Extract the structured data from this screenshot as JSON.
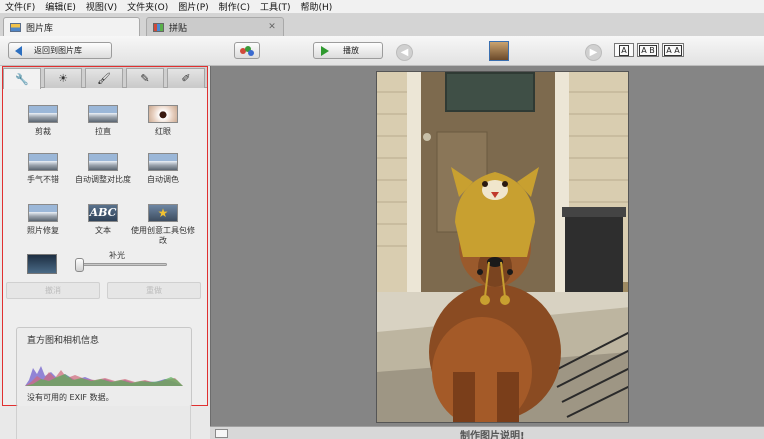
{
  "menu": [
    "文件(F)",
    "编辑(E)",
    "视图(V)",
    "文件夹(O)",
    "图片(P)",
    "制作(C)",
    "工具(T)",
    "帮助(H)"
  ],
  "tabs": [
    {
      "label": "图片库",
      "active": true
    },
    {
      "label": "拼贴",
      "active": false
    }
  ],
  "toolbar": {
    "back_label": "返回到图片库",
    "play_label": "播放",
    "view_buttons": [
      "A",
      "A B",
      "A A"
    ]
  },
  "panel": {
    "tab_icons": [
      "wrench-icon",
      "sun-icon",
      "brush-icon",
      "paint-tube-icon",
      "paint-bucket-icon"
    ],
    "tools": [
      {
        "label": "剪裁",
        "icon": "crop-icon"
      },
      {
        "label": "拉直",
        "icon": "straighten-icon"
      },
      {
        "label": "红眼",
        "icon": "red-eye-icon"
      },
      {
        "label": "手气不错",
        "icon": "feeling-lucky-icon"
      },
      {
        "label": "自动调整对比度",
        "icon": "auto-contrast-icon"
      },
      {
        "label": "自动调色",
        "icon": "auto-color-icon"
      },
      {
        "label": "照片修复",
        "icon": "retouch-icon"
      },
      {
        "label": "文本",
        "icon": "text-icon"
      },
      {
        "label": "使用创意工具包修改",
        "icon": "creative-kit-icon"
      }
    ],
    "fill_light_label": "补光",
    "fill_light_level": 0,
    "undo_label": "撤消",
    "redo_label": "重做",
    "histogram_title": "直方图和相机信息",
    "exif_text": "没有可用的 EXIF 数据。"
  },
  "caption_text": "制作图片说明!",
  "colors": {
    "panel_highlight_border": "#e03030",
    "play_icon": "#2f9a2f",
    "back_icon": "#2c6fc0"
  }
}
